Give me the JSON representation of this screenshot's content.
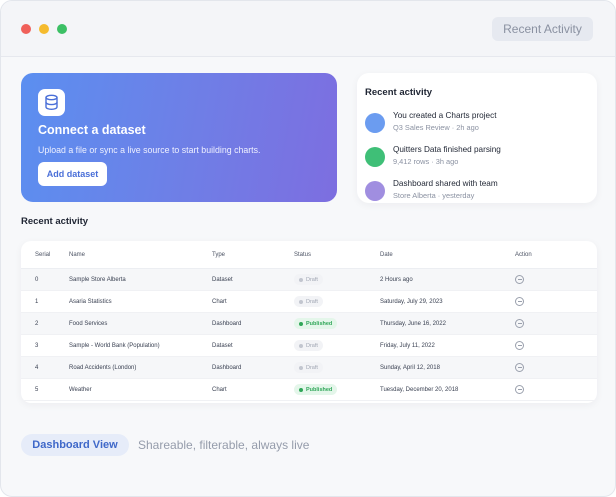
{
  "window": {
    "title": "Recent Activity"
  },
  "hero": {
    "icon": "database-icon",
    "title": "Connect a dataset",
    "subtitle": "Upload a file or sync a live source to start building charts.",
    "button_label": "Add dataset"
  },
  "activity_panel": {
    "title": "Recent activity",
    "items": [
      {
        "title": "You created a Charts project",
        "meta": "Q3 Sales Review · 2h ago",
        "color": "#6b9cf0"
      },
      {
        "title": "Quitters Data finished parsing",
        "meta": "9,412 rows · 3h ago",
        "color": "#3fbf77"
      },
      {
        "title": "Dashboard shared with team",
        "meta": "Store Alberta · yesterday",
        "color": "#a08ee0"
      }
    ]
  },
  "table": {
    "section_title": "Recent activity",
    "columns": [
      "Serial",
      "Name",
      "Type",
      "Status",
      "Date",
      "Action"
    ],
    "rows": [
      {
        "serial": "0",
        "name": "Sample Store Alberta",
        "type": "Dataset",
        "status": "Draft",
        "date": "2 Hours ago"
      },
      {
        "serial": "1",
        "name": "Asaria Statistics",
        "type": "Chart",
        "status": "Draft",
        "date": "Saturday, July 29, 2023"
      },
      {
        "serial": "2",
        "name": "Food Services",
        "type": "Dashboard",
        "status": "Published",
        "date": "Thursday, June 16, 2022"
      },
      {
        "serial": "3",
        "name": "Sample - World Bank (Population)",
        "type": "Dataset",
        "status": "Draft",
        "date": "Friday, July 11, 2022"
      },
      {
        "serial": "4",
        "name": "Road Accidents (London)",
        "type": "Dashboard",
        "status": "Draft",
        "date": "Sunday, April 12, 2018"
      },
      {
        "serial": "5",
        "name": "Weather",
        "type": "Chart",
        "status": "Published",
        "date": "Tuesday, December 20, 2018"
      }
    ]
  },
  "footer": {
    "pill_label": "Dashboard View",
    "tagline": "Shareable, filterable, always live"
  }
}
